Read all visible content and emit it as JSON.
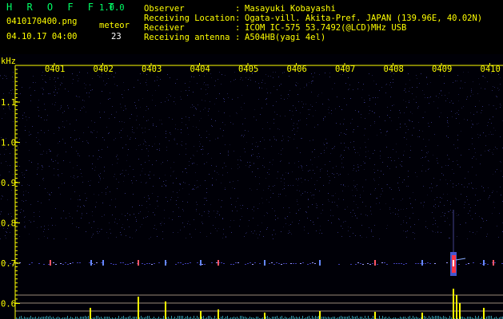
{
  "header": {
    "app_name": "H R O F F T",
    "version": "1.0.0",
    "filename": "0410170400.png",
    "datetime": "04.10.17 04:00",
    "meteor_label": "meteor",
    "meteor_count": "23",
    "info": [
      {
        "label": "Observer",
        "value": "Masayuki Kobayashi"
      },
      {
        "label": "Receiving Location",
        "value": "Ogata-vill. Akita-Pref. JAPAN (139.96E, 40.02N)"
      },
      {
        "label": "Receiver",
        "value": "ICOM IC-575 53.7492(@LCD)MHz USB"
      },
      {
        "label": "Receiving antenna",
        "value": "A504HB(yagi 4el)"
      }
    ]
  },
  "spectrogram": {
    "y_unit": "kHz",
    "y_ticks": [
      "1.1",
      "1.0",
      "0.9",
      "0.8",
      "0.7",
      "0.6"
    ],
    "time_labels": [
      "0401",
      "0402",
      "0403",
      "0404",
      "0405",
      "0406",
      "0407",
      "0408",
      "0409",
      "0410"
    ],
    "colors": {
      "axis": "#ffff00",
      "background": "#000000",
      "echo_trace": "#ff3344",
      "count_bars": "#ffff00"
    }
  }
}
